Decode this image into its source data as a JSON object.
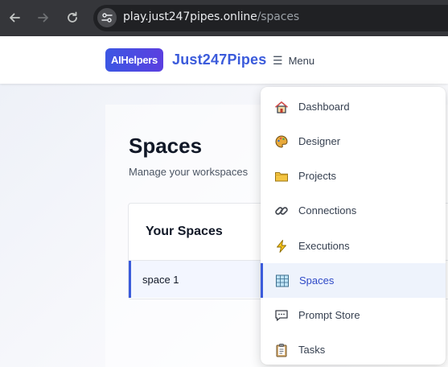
{
  "browser": {
    "url_host": "play.just247pipes.online",
    "url_path": "/spaces"
  },
  "header": {
    "badge": "AIHelpers",
    "brand": "Just247Pipes",
    "menu_label": "Menu",
    "menu_icon": "hamburger-icon"
  },
  "page": {
    "title": "Spaces",
    "subtitle": "Manage your workspaces"
  },
  "card": {
    "title": "Your Spaces",
    "spaces": [
      {
        "name": "space 1"
      }
    ]
  },
  "menu": {
    "items": [
      {
        "label": "Dashboard",
        "icon": "house-icon",
        "active": false
      },
      {
        "label": "Designer",
        "icon": "palette-icon",
        "active": false
      },
      {
        "label": "Projects",
        "icon": "folder-icon",
        "active": false
      },
      {
        "label": "Connections",
        "icon": "link-icon",
        "active": false
      },
      {
        "label": "Executions",
        "icon": "lightning-icon",
        "active": false
      },
      {
        "label": "Spaces",
        "icon": "grid-icon",
        "active": true
      },
      {
        "label": "Prompt Store",
        "icon": "chat-icon",
        "active": false
      },
      {
        "label": "Tasks",
        "icon": "clipboard-icon",
        "active": false
      }
    ]
  },
  "colors": {
    "accent": "#3b5bdb",
    "badge_from": "#3c57e3",
    "badge_to": "#5b3fe0",
    "chrome": "#35363a"
  }
}
